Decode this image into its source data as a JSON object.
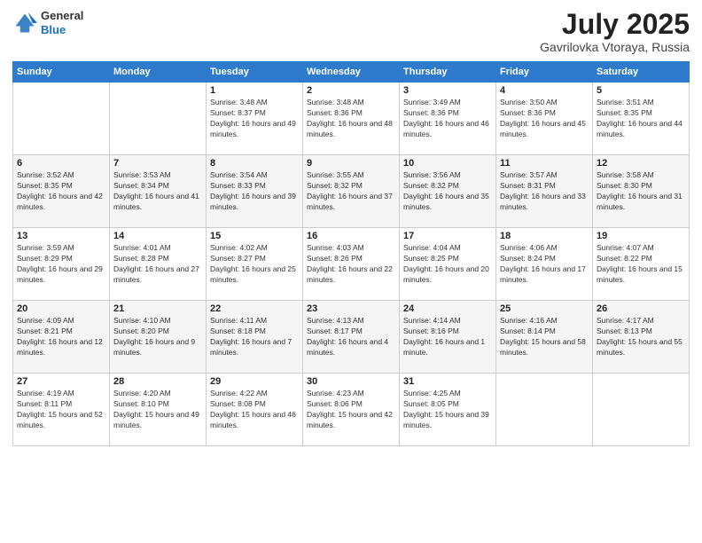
{
  "logo": {
    "general": "General",
    "blue": "Blue"
  },
  "header": {
    "month": "July 2025",
    "location": "Gavrilovka Vtoraya, Russia"
  },
  "weekdays": [
    "Sunday",
    "Monday",
    "Tuesday",
    "Wednesday",
    "Thursday",
    "Friday",
    "Saturday"
  ],
  "weeks": [
    [
      {
        "day": "",
        "sunrise": "",
        "sunset": "",
        "daylight": ""
      },
      {
        "day": "",
        "sunrise": "",
        "sunset": "",
        "daylight": ""
      },
      {
        "day": "1",
        "sunrise": "Sunrise: 3:48 AM",
        "sunset": "Sunset: 8:37 PM",
        "daylight": "Daylight: 16 hours and 49 minutes."
      },
      {
        "day": "2",
        "sunrise": "Sunrise: 3:48 AM",
        "sunset": "Sunset: 8:36 PM",
        "daylight": "Daylight: 16 hours and 48 minutes."
      },
      {
        "day": "3",
        "sunrise": "Sunrise: 3:49 AM",
        "sunset": "Sunset: 8:36 PM",
        "daylight": "Daylight: 16 hours and 46 minutes."
      },
      {
        "day": "4",
        "sunrise": "Sunrise: 3:50 AM",
        "sunset": "Sunset: 8:36 PM",
        "daylight": "Daylight: 16 hours and 45 minutes."
      },
      {
        "day": "5",
        "sunrise": "Sunrise: 3:51 AM",
        "sunset": "Sunset: 8:35 PM",
        "daylight": "Daylight: 16 hours and 44 minutes."
      }
    ],
    [
      {
        "day": "6",
        "sunrise": "Sunrise: 3:52 AM",
        "sunset": "Sunset: 8:35 PM",
        "daylight": "Daylight: 16 hours and 42 minutes."
      },
      {
        "day": "7",
        "sunrise": "Sunrise: 3:53 AM",
        "sunset": "Sunset: 8:34 PM",
        "daylight": "Daylight: 16 hours and 41 minutes."
      },
      {
        "day": "8",
        "sunrise": "Sunrise: 3:54 AM",
        "sunset": "Sunset: 8:33 PM",
        "daylight": "Daylight: 16 hours and 39 minutes."
      },
      {
        "day": "9",
        "sunrise": "Sunrise: 3:55 AM",
        "sunset": "Sunset: 8:32 PM",
        "daylight": "Daylight: 16 hours and 37 minutes."
      },
      {
        "day": "10",
        "sunrise": "Sunrise: 3:56 AM",
        "sunset": "Sunset: 8:32 PM",
        "daylight": "Daylight: 16 hours and 35 minutes."
      },
      {
        "day": "11",
        "sunrise": "Sunrise: 3:57 AM",
        "sunset": "Sunset: 8:31 PM",
        "daylight": "Daylight: 16 hours and 33 minutes."
      },
      {
        "day": "12",
        "sunrise": "Sunrise: 3:58 AM",
        "sunset": "Sunset: 8:30 PM",
        "daylight": "Daylight: 16 hours and 31 minutes."
      }
    ],
    [
      {
        "day": "13",
        "sunrise": "Sunrise: 3:59 AM",
        "sunset": "Sunset: 8:29 PM",
        "daylight": "Daylight: 16 hours and 29 minutes."
      },
      {
        "day": "14",
        "sunrise": "Sunrise: 4:01 AM",
        "sunset": "Sunset: 8:28 PM",
        "daylight": "Daylight: 16 hours and 27 minutes."
      },
      {
        "day": "15",
        "sunrise": "Sunrise: 4:02 AM",
        "sunset": "Sunset: 8:27 PM",
        "daylight": "Daylight: 16 hours and 25 minutes."
      },
      {
        "day": "16",
        "sunrise": "Sunrise: 4:03 AM",
        "sunset": "Sunset: 8:26 PM",
        "daylight": "Daylight: 16 hours and 22 minutes."
      },
      {
        "day": "17",
        "sunrise": "Sunrise: 4:04 AM",
        "sunset": "Sunset: 8:25 PM",
        "daylight": "Daylight: 16 hours and 20 minutes."
      },
      {
        "day": "18",
        "sunrise": "Sunrise: 4:06 AM",
        "sunset": "Sunset: 8:24 PM",
        "daylight": "Daylight: 16 hours and 17 minutes."
      },
      {
        "day": "19",
        "sunrise": "Sunrise: 4:07 AM",
        "sunset": "Sunset: 8:22 PM",
        "daylight": "Daylight: 16 hours and 15 minutes."
      }
    ],
    [
      {
        "day": "20",
        "sunrise": "Sunrise: 4:09 AM",
        "sunset": "Sunset: 8:21 PM",
        "daylight": "Daylight: 16 hours and 12 minutes."
      },
      {
        "day": "21",
        "sunrise": "Sunrise: 4:10 AM",
        "sunset": "Sunset: 8:20 PM",
        "daylight": "Daylight: 16 hours and 9 minutes."
      },
      {
        "day": "22",
        "sunrise": "Sunrise: 4:11 AM",
        "sunset": "Sunset: 8:18 PM",
        "daylight": "Daylight: 16 hours and 7 minutes."
      },
      {
        "day": "23",
        "sunrise": "Sunrise: 4:13 AM",
        "sunset": "Sunset: 8:17 PM",
        "daylight": "Daylight: 16 hours and 4 minutes."
      },
      {
        "day": "24",
        "sunrise": "Sunrise: 4:14 AM",
        "sunset": "Sunset: 8:16 PM",
        "daylight": "Daylight: 16 hours and 1 minute."
      },
      {
        "day": "25",
        "sunrise": "Sunrise: 4:16 AM",
        "sunset": "Sunset: 8:14 PM",
        "daylight": "Daylight: 15 hours and 58 minutes."
      },
      {
        "day": "26",
        "sunrise": "Sunrise: 4:17 AM",
        "sunset": "Sunset: 8:13 PM",
        "daylight": "Daylight: 15 hours and 55 minutes."
      }
    ],
    [
      {
        "day": "27",
        "sunrise": "Sunrise: 4:19 AM",
        "sunset": "Sunset: 8:11 PM",
        "daylight": "Daylight: 15 hours and 52 minutes."
      },
      {
        "day": "28",
        "sunrise": "Sunrise: 4:20 AM",
        "sunset": "Sunset: 8:10 PM",
        "daylight": "Daylight: 15 hours and 49 minutes."
      },
      {
        "day": "29",
        "sunrise": "Sunrise: 4:22 AM",
        "sunset": "Sunset: 8:08 PM",
        "daylight": "Daylight: 15 hours and 46 minutes."
      },
      {
        "day": "30",
        "sunrise": "Sunrise: 4:23 AM",
        "sunset": "Sunset: 8:06 PM",
        "daylight": "Daylight: 15 hours and 42 minutes."
      },
      {
        "day": "31",
        "sunrise": "Sunrise: 4:25 AM",
        "sunset": "Sunset: 8:05 PM",
        "daylight": "Daylight: 15 hours and 39 minutes."
      },
      {
        "day": "",
        "sunrise": "",
        "sunset": "",
        "daylight": ""
      },
      {
        "day": "",
        "sunrise": "",
        "sunset": "",
        "daylight": ""
      }
    ]
  ]
}
